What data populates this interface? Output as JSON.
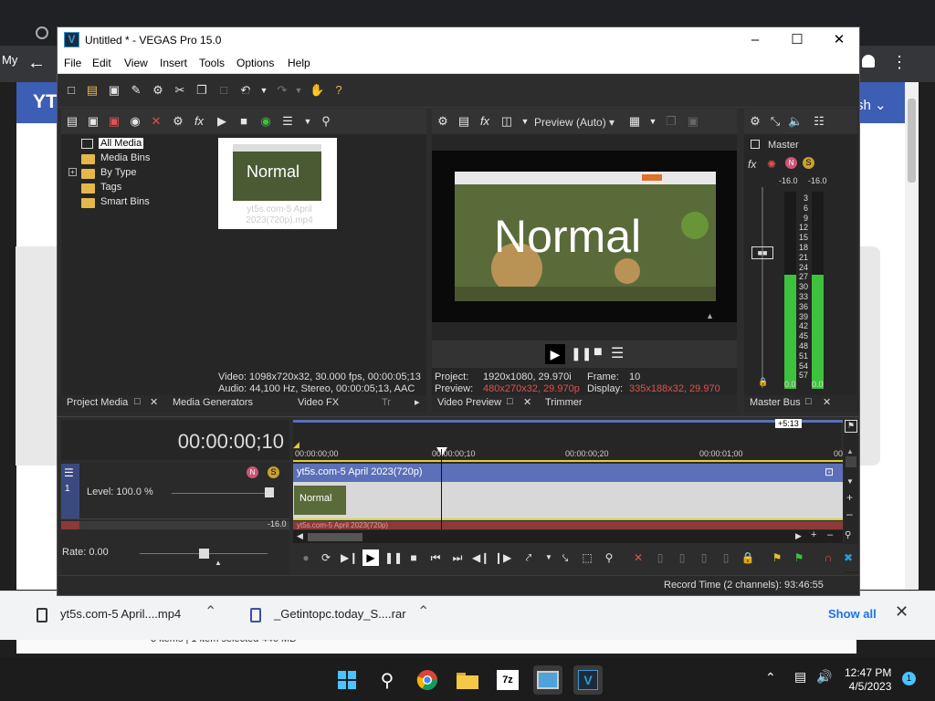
{
  "browser": {
    "side_label": "My",
    "yt_label": "YT",
    "button_partial": "sh",
    "explorer_status": "3 items  |  1 item selected  446 MB"
  },
  "downloads": [
    {
      "name": "yt5s.com-5 April....mp4"
    },
    {
      "name": "_Getintopc.today_S....rar"
    }
  ],
  "downloads_show_all": "Show all",
  "taskbar": {
    "time": "12:47 PM",
    "date": "4/5/2023",
    "notifications": "1"
  },
  "window": {
    "title": "Untitled * - VEGAS Pro 15.0",
    "logo": "V",
    "menu": [
      "File",
      "Edit",
      "View",
      "Insert",
      "Tools",
      "Options",
      "Help"
    ]
  },
  "media": {
    "tree": [
      "All Media",
      "Media Bins",
      "By Type",
      "Tags",
      "Smart Bins"
    ],
    "thumbnail_text": "Normal",
    "thumbnail_name": "yt5s.com-5 April 2023(720p).mp4",
    "video_info": "Video: 1098x720x32, 30.000 fps, 00:00:05;13",
    "audio_info": "Audio: 44,100 Hz, Stereo, 00:00:05;13, AAC"
  },
  "tabs_left": [
    "Project Media",
    "Media Generators",
    "Video FX",
    "Tr"
  ],
  "preview": {
    "mode": "Preview (Auto)",
    "overlay_text": "Normal",
    "project_label": "Project:",
    "project_value": "1920x1080, 29.970i",
    "preview_label": "Preview:",
    "preview_value": "480x270x32, 29.970p",
    "frame_label": "Frame:",
    "frame_value": "10",
    "display_label": "Display:",
    "display_value": "335x188x32, 29.970"
  },
  "tabs_mid": [
    "Video Preview",
    "Trimmer"
  ],
  "master": {
    "label": "Master",
    "left_peak": "-16.0",
    "right_peak": "-16.0",
    "scale": [
      "3",
      "6",
      "9",
      "12",
      "15",
      "18",
      "21",
      "24",
      "27",
      "30",
      "33",
      "36",
      "39",
      "42",
      "45",
      "48",
      "51",
      "54",
      "57"
    ],
    "bottom_left": "0.0",
    "bottom_right": "0.0",
    "left_level": 0.58,
    "right_level": 0.58,
    "tab": "Master Bus"
  },
  "timeline": {
    "timecode": "00:00:00;10",
    "duration_badge": "+5:13",
    "ruler": [
      "00:00:00;00",
      "00:00:00;10",
      "00:00:00;20",
      "00:00:01;00",
      "00"
    ],
    "track_level": "Level: 100.0 %",
    "track_number": "1",
    "clip_title": "yt5s.com-5 April 2023(720p)",
    "clip_thumb_text": "Normal",
    "audio_clip_title": "yt5s.com-5 April 2023(720p)",
    "audio_level": "-16.0",
    "rate": "Rate: 0.00",
    "record_time": "Record Time (2 channels): 93:46:55"
  }
}
